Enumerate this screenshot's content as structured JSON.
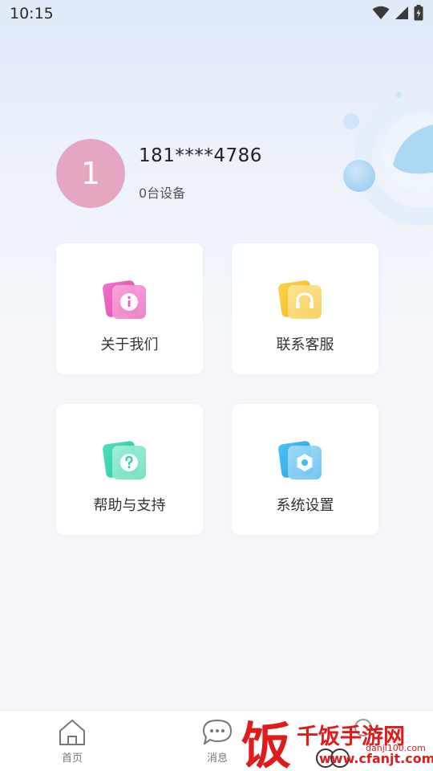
{
  "status_bar": {
    "time": "10:15",
    "icons": [
      "wifi-icon",
      "signal-icon",
      "battery-charging-icon"
    ]
  },
  "profile": {
    "avatar_text": "1",
    "avatar_color": "#e4a6c0",
    "phone": "181****4786",
    "device_count": "0台设备"
  },
  "menu": {
    "items": [
      {
        "label": "关于我们",
        "icon": "info-icon",
        "color": "#e85bb8"
      },
      {
        "label": "联系客服",
        "icon": "headset-icon",
        "color": "#f4c43a"
      },
      {
        "label": "帮助与支持",
        "icon": "help-icon",
        "color": "#3ed3b0"
      },
      {
        "label": "系统设置",
        "icon": "settings-icon",
        "color": "#3fb2ee"
      }
    ]
  },
  "tabbar": {
    "tabs": [
      {
        "label": "首页",
        "icon": "home-icon"
      },
      {
        "label": "消息",
        "icon": "chat-icon"
      }
    ]
  },
  "watermark": {
    "brand": "千饭手游网",
    "logo_char": "饭",
    "url": "www.cfanjt.com",
    "url_small": "danji100.com"
  },
  "colors": {
    "accent_blue": "#a9d7f3",
    "background": "#f4f6fa"
  }
}
